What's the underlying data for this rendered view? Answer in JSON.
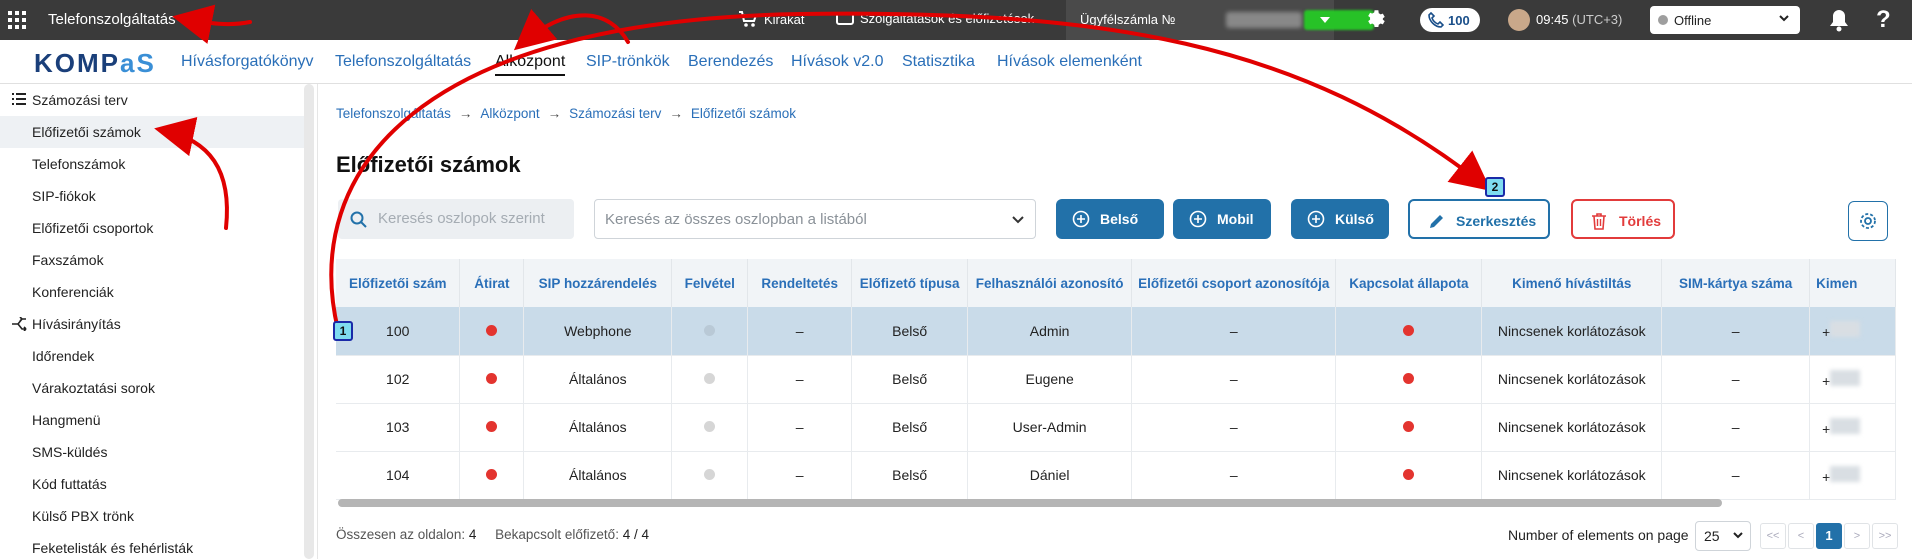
{
  "topbar": {
    "title": "Telefonszolgáltatás",
    "showcase": "Kirakat",
    "services": "Szolgáltatások és előfizetések",
    "account_label": "Ügyfélszámla №",
    "calls_count": "100",
    "time": "09:45",
    "timezone": "(UTC+3)",
    "status": "Offline",
    "help": "?"
  },
  "nav": {
    "logo_main": "KOMP",
    "logo_tail": "aS",
    "items": [
      "Hívásforgatókönyv",
      "Telefonszolgáltatás",
      "Alközpont",
      "SIP-trönkök",
      "Berendezés",
      "Hívások v2.0",
      "Statisztika",
      "Hívások elemenként"
    ]
  },
  "sidebar": {
    "items": [
      "Számozási terv",
      "Előfizetői számok",
      "Telefonszámok",
      "SIP-fiókok",
      "Előfizetői csoportok",
      "Faxszámok",
      "Konferenciák",
      "Hívásirányítás",
      "Időrendek",
      "Várakoztatási sorok",
      "Hangmenü",
      "SMS-küldés",
      "Kód futtatás",
      "Külső PBX trönk",
      "Feketelisták és fehérlisták"
    ]
  },
  "breadcrumbs": [
    "Telefonszolgáltatás",
    "Alközpont",
    "Számozási terv",
    "Előfizetői számok"
  ],
  "page_title": "Előfizetői számok",
  "toolbar": {
    "search_columns_placeholder": "Keresés oszlopok szerint",
    "search_all_placeholder": "Keresés az összes oszlopban a listából",
    "btn_internal": "Belső",
    "btn_mobile": "Mobil",
    "btn_external": "Külső",
    "btn_edit": "Szerkesztés",
    "btn_delete": "Törlés"
  },
  "table": {
    "columns": [
      "Előfizetői szám",
      "Átirat",
      "SIP hozzárendelés",
      "Felvétel",
      "Rendeltetés",
      "Előfizető típusa",
      "Felhasználói azonosító",
      "Előfizetői csoport azonosítója",
      "Kapcsolat állapota",
      "Kimenő hívástiltás",
      "SIM-kártya száma",
      "Kimen"
    ],
    "rows": [
      {
        "number": "100",
        "sip": "Webphone",
        "purpose": "–",
        "type": "Belső",
        "user": "Admin",
        "group": "–",
        "restriction": "Nincsenek korlátozások",
        "sim": "–",
        "last": "+"
      },
      {
        "number": "102",
        "sip": "Általános",
        "purpose": "–",
        "type": "Belső",
        "user": "Eugene",
        "group": "–",
        "restriction": "Nincsenek korlátozások",
        "sim": "–",
        "last": "+"
      },
      {
        "number": "103",
        "sip": "Általános",
        "purpose": "–",
        "type": "Belső",
        "user": "User-Admin",
        "group": "–",
        "restriction": "Nincsenek korlátozások",
        "sim": "–",
        "last": "+"
      },
      {
        "number": "104",
        "sip": "Általános",
        "purpose": "–",
        "type": "Belső",
        "user": "Dániel",
        "group": "–",
        "restriction": "Nincsenek korlátozások",
        "sim": "–",
        "last": "+"
      }
    ]
  },
  "footer": {
    "total_label": "Összesen az oldalon:",
    "total_value": "4",
    "connected_label": "Bekapcsolt előfizető:",
    "connected_value": "4 / 4",
    "per_page_label": "Number of elements on page",
    "per_page_value": "25",
    "current_page": "1",
    "first": "<<",
    "prev": "<",
    "next": ">",
    "last": ">>"
  },
  "annotations": {
    "badge1": "1",
    "badge2": "2"
  },
  "colors": {
    "accent": "#2271a9",
    "danger": "#e23b3b",
    "arrow": "#e00000"
  }
}
